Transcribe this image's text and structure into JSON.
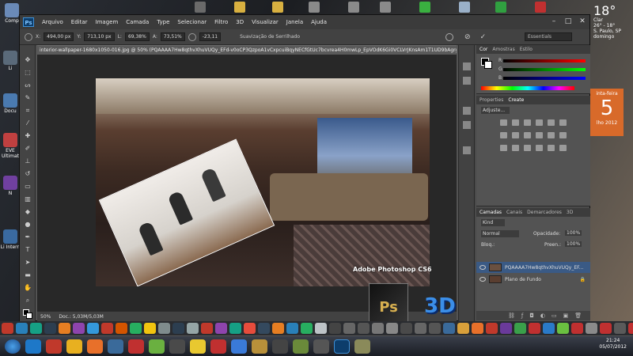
{
  "desktop": {
    "icons": [
      {
        "label": "Comp",
        "name": "computer"
      },
      {
        "label": "Li",
        "name": "library"
      },
      {
        "label": "Docu",
        "name": "documents"
      },
      {
        "label": "EVE Ultimat",
        "name": "eve-ultimate"
      },
      {
        "label": "N",
        "name": "n-app"
      },
      {
        "label": "Li Intern",
        "name": "internet"
      }
    ],
    "weather": {
      "temp": "18°",
      "line1": "Clar",
      "line2": "26° - 18°",
      "city": "S. Paulo, SP",
      "extra": "domingo"
    },
    "calendar": {
      "weekday": "inta-feira",
      "day": "5",
      "monthyear": "lho 2012"
    }
  },
  "photoshop": {
    "logo": "Ps",
    "menus": [
      "Arquivo",
      "Editar",
      "Imagem",
      "Camada",
      "Type",
      "Selecionar",
      "Filtro",
      "3D",
      "Visualizar",
      "Janela",
      "Ajuda"
    ],
    "window_controls": {
      "minimize": "–",
      "maximize": "□",
      "close": "✕"
    },
    "options": {
      "x_label": "X:",
      "x_value": "494,00 px",
      "y_label": "Y:",
      "y_value": "713,10 px",
      "w_label": "L:",
      "w_value": "69,38%",
      "h_label": "A:",
      "h_value": "73,51%",
      "angle_value": "-23,11",
      "interp": "Suavização de Serrilhado",
      "workspace": "Essentials"
    },
    "document_tab": "interior-wallpaper-1680x1050-016.jpg @ 50% (PQAAAA7Hw8qthvXhuVUQy_EFd-v0oCP3QzpoA1vCxpcuiBqyNECfGtUc7bcvrea4H0mwLp_EpVOdK6Gi0VCLVrJKnsAm1T1UD9bAgrgBs2AEL1swG69...",
    "status": {
      "zoom": "50%",
      "doc": "Doc.: 5,03M/5,03M"
    },
    "color_panel": {
      "tabs": [
        "Cor",
        "Amostras",
        "Estilo"
      ],
      "channels": [
        "R",
        "G",
        "B"
      ]
    },
    "adjust_panel": {
      "tabs": [
        "Properties",
        "Create"
      ],
      "label": "Adjuste..."
    },
    "layers_panel": {
      "tabs": [
        "Camadas",
        "Canais",
        "Demarcadores",
        "3D"
      ],
      "kind": "Kind",
      "blend_mode": "Normal",
      "opacity_label": "Opacidade:",
      "opacity": "100%",
      "lock_label": "Bloq.:",
      "fill_label": "Preen.:",
      "fill": "100%",
      "layers": [
        {
          "name": "PQAAAA7Hw8qthvXhuVUQy_EF...",
          "selected": true
        },
        {
          "name": "Plano de Fundo",
          "selected": false
        }
      ]
    }
  },
  "overlay": {
    "title": "Adobe Photoshop CS6",
    "box_text": "Ps",
    "badge": "3D"
  },
  "taskbar": {
    "time": "21:24",
    "date": "05/07/2012"
  }
}
